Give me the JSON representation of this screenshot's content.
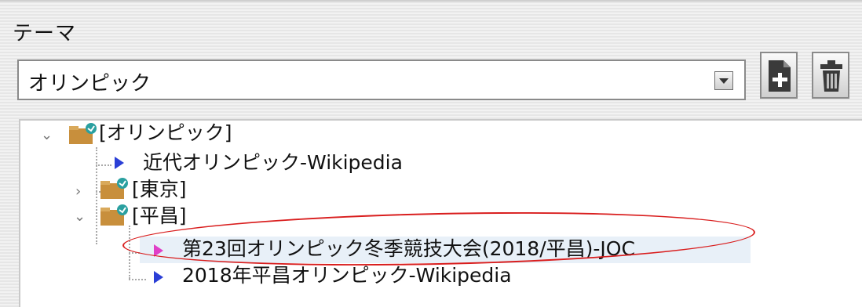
{
  "panel": {
    "section_label": "テーマ",
    "combo_value": "オリンピック"
  },
  "toolbar": {
    "new_icon": "new-document-plus-icon",
    "delete_icon": "trash-icon"
  },
  "tree": {
    "nodes": [
      {
        "label": "[オリンピック]",
        "type": "folder",
        "expanded": true
      },
      {
        "label": "近代オリンピック-Wikipedia",
        "type": "link",
        "color": "#2b3fd6"
      },
      {
        "label": "[東京]",
        "type": "folder",
        "expanded": false
      },
      {
        "label": "[平昌]",
        "type": "folder",
        "expanded": true
      },
      {
        "label": "第23回オリンピック冬季競技大会(2018/平昌)-JOC",
        "type": "link",
        "color": "#e040c8",
        "selected": true
      },
      {
        "label": "2018年平昌オリンピック-Wikipedia",
        "type": "link",
        "color": "#2b3fd6"
      }
    ]
  },
  "colors": {
    "highlight_ellipse": "#d91e1e",
    "selected_row": "#e8f0f8",
    "link_blue": "#2b3fd6",
    "link_magenta": "#e040c8"
  }
}
